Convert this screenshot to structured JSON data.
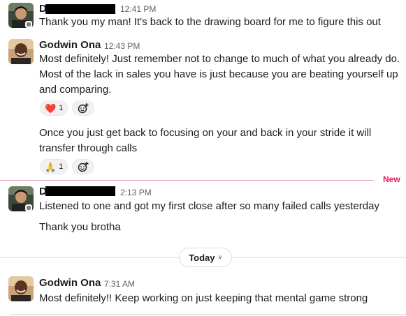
{
  "messages": [
    {
      "sender": "D",
      "time": "12:41 PM",
      "lines": [
        "Thank you my man! It's back to the drawing board for me to figure this out"
      ]
    },
    {
      "sender": "Godwin Ona",
      "time": "12:43 PM",
      "lines": [
        "Most definitely! Just remember not to change to much of what you already do.",
        "Most of the lack in sales you have is just because you are beating yourself up",
        "and comparing."
      ],
      "reaction": {
        "emoji": "❤️",
        "count": "1"
      },
      "followup_lines": [
        "Once you just get back to focusing on your and back in your stride it will",
        "transfer through calls"
      ],
      "followup_reaction": {
        "emoji": "🙏",
        "count": "1"
      }
    },
    {
      "sender": "D",
      "time": "2:13 PM",
      "lines": [
        "Listened to one and got my first close after so many failed calls yesterday",
        "Thank you brotha"
      ]
    },
    {
      "sender": "Godwin Ona",
      "time": "7:31 AM",
      "lines": [
        "Most definitely!! Keep working on just keeping that mental game strong"
      ]
    }
  ],
  "divider_new": "New",
  "day_divider": {
    "label": "Today",
    "chevron": "˅"
  },
  "icons": {
    "add_reaction": "add-reaction-icon",
    "presence": "presence-status-icon"
  },
  "colors": {
    "new_accent": "#e01e5a",
    "timestamp": "#616061"
  }
}
